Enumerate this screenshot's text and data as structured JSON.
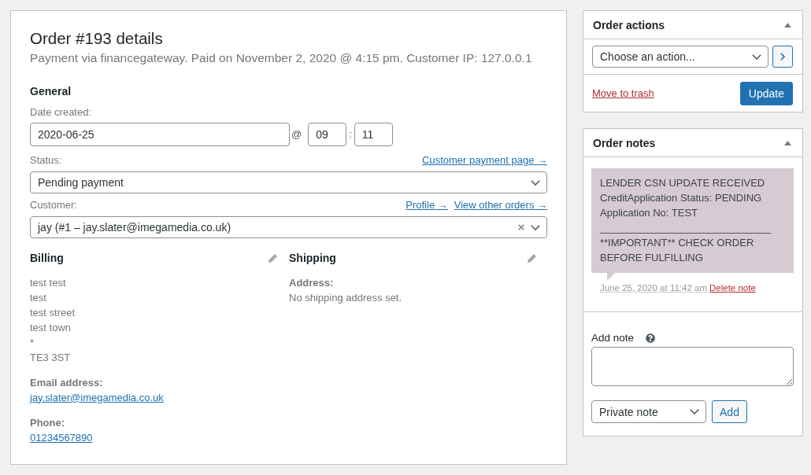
{
  "order": {
    "title": "Order #193 details",
    "meta": "Payment via financegateway. Paid on November 2, 2020 @ 4:15 pm. Customer IP: 127.0.0.1",
    "general": {
      "heading": "General",
      "date_created": {
        "label": "Date created:",
        "date": "2020-06-25",
        "at": "@",
        "hour": "09",
        "separator": ":",
        "minute": "11"
      },
      "status": {
        "label": "Status:",
        "links": [
          "Customer payment page →"
        ],
        "value": "Pending payment"
      },
      "customer": {
        "label": "Customer:",
        "links": [
          "Profile →",
          "View other orders →"
        ],
        "value": "jay (#1 – jay.slater@imegamedia.co.uk)",
        "clearable": true
      }
    },
    "billing": {
      "heading": "Billing",
      "editable": true,
      "address_lines": [
        "test test",
        "test",
        "test street",
        "test town",
        "*",
        "TE3 3ST"
      ],
      "fields": [
        {
          "kind": "link",
          "label": "Email address:",
          "value": "jay.slater@imegamedia.co.uk"
        },
        {
          "kind": "link",
          "label": "Phone:",
          "value": "01234567890"
        }
      ]
    },
    "shipping": {
      "heading": "Shipping",
      "editable": true,
      "fields": [
        {
          "kind": "text",
          "label": "Address:",
          "value": "No shipping address set."
        }
      ]
    }
  },
  "order_actions": {
    "title": "Order actions",
    "expanded": true,
    "action_select": "Choose an action...",
    "trash_link": "Move to trash",
    "update_button": "Update"
  },
  "order_notes": {
    "title": "Order notes",
    "expanded": true,
    "notes": [
      {
        "kind": "system",
        "text": "LENDER CSN UPDATE RECEIVED\nCreditApplication Status: PENDING\nApplication No: TEST\n______________________________\n**IMPORTANT** CHECK ORDER\nBEFORE FULFILLING",
        "date": "June 25, 2020 at 11:42 am",
        "delete_link": "Delete note"
      }
    ],
    "add_note": {
      "label": "Add note",
      "note_type": "Private note",
      "button": "Add"
    }
  }
}
